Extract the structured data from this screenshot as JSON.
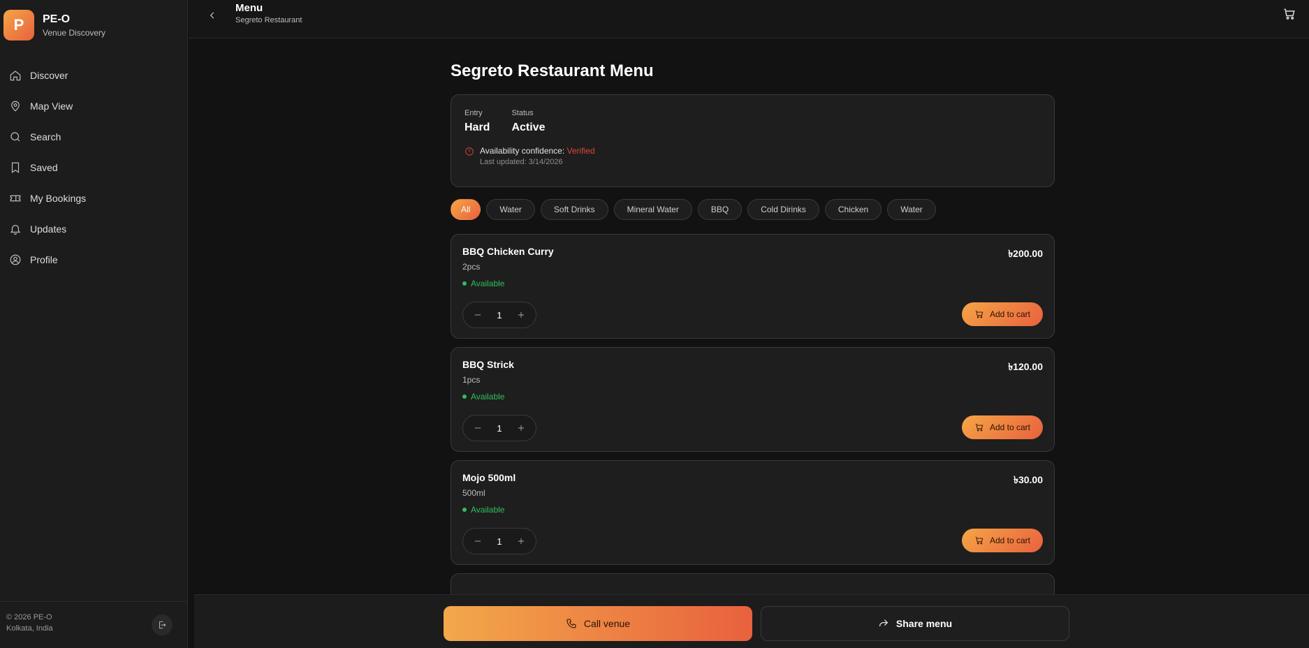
{
  "brand": {
    "logo_letter": "P",
    "name": "PE-O",
    "tagline": "Venue Discovery"
  },
  "sidebar": {
    "items": [
      {
        "label": "Discover",
        "icon": "home-icon"
      },
      {
        "label": "Map View",
        "icon": "map-pin-icon"
      },
      {
        "label": "Search",
        "icon": "search-icon"
      },
      {
        "label": "Saved",
        "icon": "bookmark-icon"
      },
      {
        "label": "My Bookings",
        "icon": "ticket-icon"
      },
      {
        "label": "Updates",
        "icon": "bell-icon"
      },
      {
        "label": "Profile",
        "icon": "user-circle-icon"
      }
    ],
    "footer": {
      "copyright": "© 2026 PE-O",
      "location": "Kolkata, India"
    }
  },
  "header": {
    "title": "Menu",
    "subtitle": "Segreto Restaurant"
  },
  "main": {
    "title": "Segreto Restaurant Menu",
    "info": {
      "entry_label": "Entry",
      "entry_value": "Hard",
      "status_label": "Status",
      "status_value": "Active",
      "confidence_label": "Availability confidence:",
      "confidence_value": "Verified",
      "last_updated": "Last updated: 3/14/2026"
    },
    "filters": [
      "All",
      "Water",
      "Soft Drinks",
      "Mineral Water",
      "BBQ",
      "Cold Dirinks",
      "Chicken",
      "Water"
    ],
    "active_filter": "All",
    "items": [
      {
        "name": "BBQ Chicken Curry",
        "unit": "2pcs",
        "price": "৳200.00",
        "status": "Available",
        "qty": "1",
        "cta": "Add to cart"
      },
      {
        "name": "BBQ Strick",
        "unit": "1pcs",
        "price": "৳120.00",
        "status": "Available",
        "qty": "1",
        "cta": "Add to cart"
      },
      {
        "name": "Mojo 500ml",
        "unit": "500ml",
        "price": "৳30.00",
        "status": "Available",
        "qty": "1",
        "cta": "Add to cart"
      }
    ]
  },
  "actions": {
    "call": "Call venue",
    "share": "Share menu"
  },
  "colors": {
    "accent_start": "#f5a546",
    "accent_end": "#e8613e",
    "available": "#2fbf5a",
    "verified": "#e0463b",
    "background": "#121212"
  }
}
